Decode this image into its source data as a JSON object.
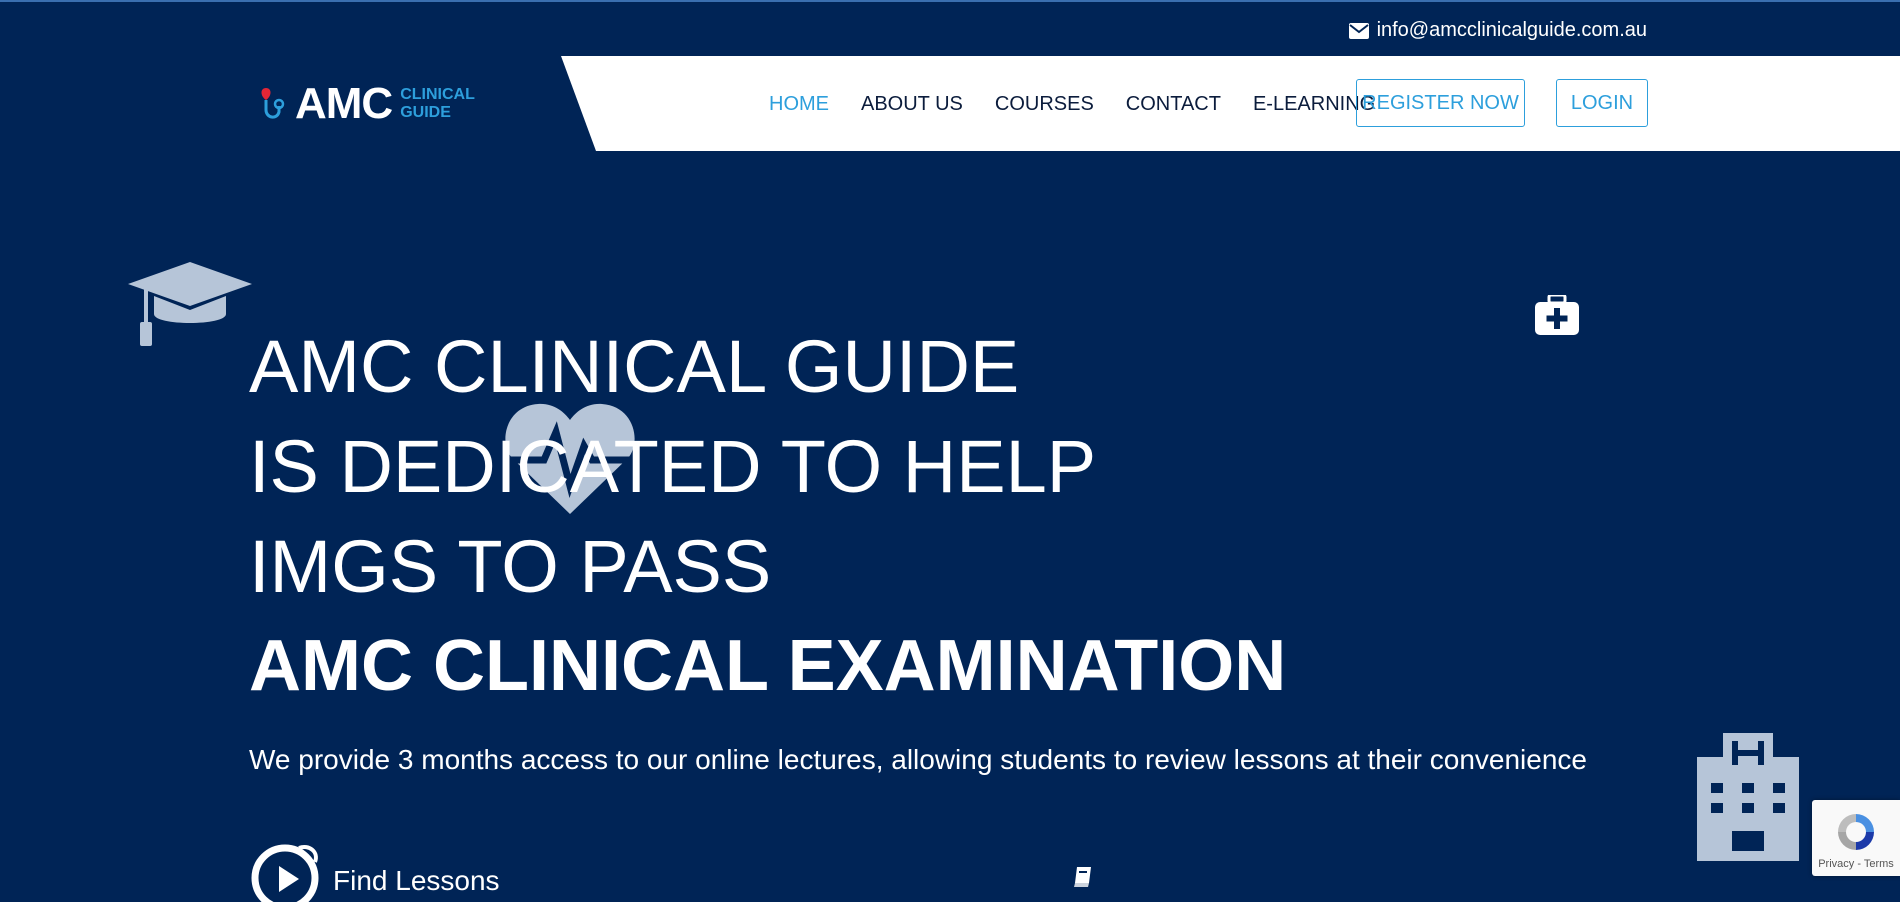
{
  "topbar": {
    "email": "info@amcclinicalguide.com.au",
    "email_icon": "envelope-icon"
  },
  "logo": {
    "text": "AMC",
    "sub_line1": "CLINICAL",
    "sub_line2": "GUIDE",
    "icon": "stethoscope-heart-icon"
  },
  "nav": {
    "items": [
      {
        "label": "HOME",
        "active": true
      },
      {
        "label": "ABOUT US"
      },
      {
        "label": "COURSES"
      },
      {
        "label": "CONTACT"
      },
      {
        "label": "E-LEARNING"
      }
    ],
    "register_label": "REGISTER NOW",
    "login_label": "LOGIN"
  },
  "hero": {
    "line1": "AMC CLINICAL GUIDE",
    "line2": "IS DEDICATED TO HELP",
    "line3": "IMGS TO PASS",
    "line4": "AMC CLINICAL EXAMINATION",
    "subtitle": "We provide 3 months access to our online lectures, allowing students to review lessons at their convenience",
    "find_label": "Find Lessons"
  },
  "decor_icons": [
    "graduation-cap-icon",
    "first-aid-kit-icon",
    "heartbeat-icon",
    "hospital-icon",
    "book-icon",
    "play-icon",
    "recaptcha-icon"
  ],
  "recaptcha": {
    "text": "Privacy - Terms"
  },
  "colors": {
    "background": "#002456",
    "accent": "#2d9fdc",
    "nav_text": "#0b1c3c",
    "icon_muted": "#b6c5d8"
  }
}
